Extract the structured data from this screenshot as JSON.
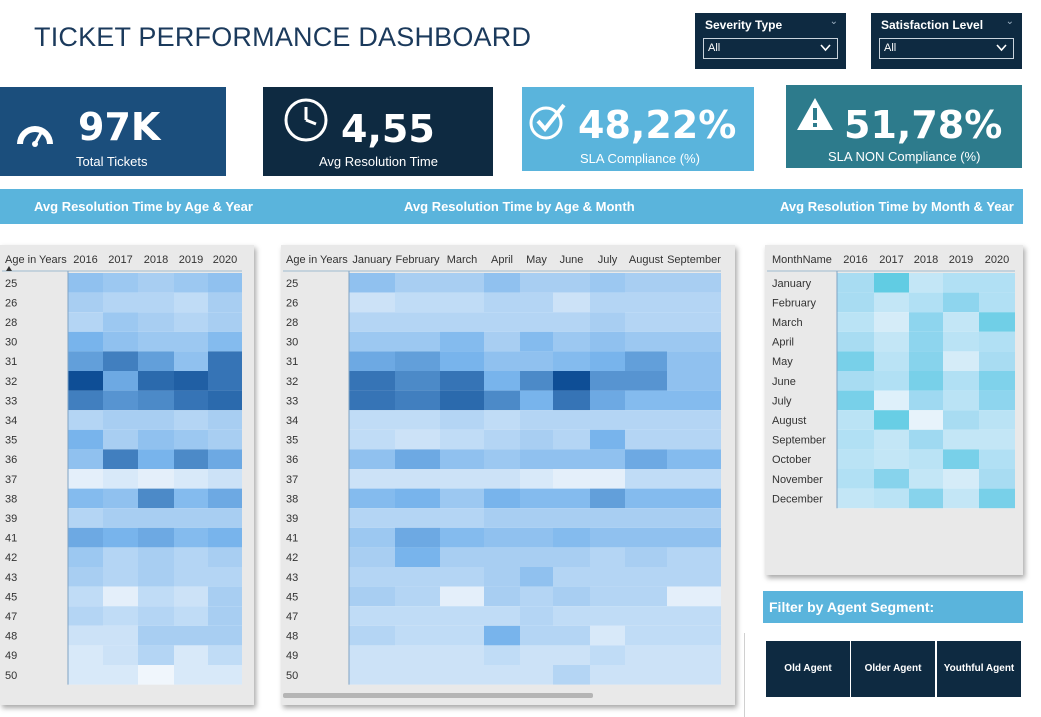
{
  "title": "TICKET PERFORMANCE DASHBOARD",
  "slicers": [
    {
      "label": "Severity Type",
      "value": "All"
    },
    {
      "label": "Satisfaction Level",
      "value": "All"
    }
  ],
  "kpis": [
    {
      "value": "97K",
      "label": "Total Tickets",
      "icon": "speedometer-icon",
      "bg": "#1b4e7c"
    },
    {
      "value": "4,55",
      "label": "Avg Resolution Time",
      "icon": "clock-icon",
      "bg": "#0e2a41"
    },
    {
      "value": "48,22%",
      "label": "SLA Compliance (%)",
      "icon": "check-circle-icon",
      "bg": "#5ab4dc"
    },
    {
      "value": "51,78%",
      "label": "SLA NON Compliance (%)",
      "icon": "warning-icon",
      "bg": "#2d7b8c"
    }
  ],
  "headings": {
    "left": "Avg Resolution Time by Age & Year",
    "mid": "Avg Resolution Time by Age & Month",
    "right": "Avg Resolution Time by Month & Year"
  },
  "filter": {
    "title": "Filter by Agent Segment:",
    "buttons": [
      "Old Agent",
      "Older Agent",
      "Youthful Agent"
    ]
  },
  "chart_data": [
    {
      "type": "heatmap",
      "title": "Avg Resolution Time by Age & Year",
      "row_header": "Age in Years",
      "columns": [
        "2016",
        "2017",
        "2018",
        "2019",
        "2020"
      ],
      "rows": [
        "25",
        "26",
        "28",
        "30",
        "31",
        "32",
        "33",
        "34",
        "35",
        "36",
        "37",
        "38",
        "39",
        "41",
        "42",
        "43",
        "45",
        "47",
        "48",
        "49",
        "50"
      ],
      "values": [
        [
          0.4,
          0.35,
          0.3,
          0.35,
          0.4
        ],
        [
          0.3,
          0.25,
          0.25,
          0.2,
          0.3
        ],
        [
          0.25,
          0.35,
          0.3,
          0.25,
          0.3
        ],
        [
          0.5,
          0.4,
          0.35,
          0.35,
          0.45
        ],
        [
          0.6,
          0.75,
          0.6,
          0.4,
          0.8
        ],
        [
          0.98,
          0.55,
          0.85,
          0.9,
          0.8
        ],
        [
          0.75,
          0.65,
          0.7,
          0.8,
          0.85
        ],
        [
          0.25,
          0.3,
          0.3,
          0.25,
          0.3
        ],
        [
          0.5,
          0.3,
          0.4,
          0.35,
          0.3
        ],
        [
          0.4,
          0.75,
          0.5,
          0.7,
          0.55
        ],
        [
          0.05,
          0.1,
          0.05,
          0.1,
          0.15
        ],
        [
          0.45,
          0.4,
          0.7,
          0.45,
          0.55
        ],
        [
          0.25,
          0.3,
          0.3,
          0.3,
          0.3
        ],
        [
          0.55,
          0.5,
          0.55,
          0.45,
          0.5
        ],
        [
          0.35,
          0.25,
          0.3,
          0.25,
          0.3
        ],
        [
          0.3,
          0.25,
          0.3,
          0.25,
          0.25
        ],
        [
          0.2,
          0.05,
          0.2,
          0.15,
          0.3
        ],
        [
          0.25,
          0.2,
          0.25,
          0.2,
          0.3
        ],
        [
          0.15,
          0.15,
          0.3,
          0.3,
          0.3
        ],
        [
          0.1,
          0.15,
          0.25,
          0.1,
          0.2
        ],
        [
          0.1,
          0.1,
          0.0,
          0.1,
          0.1
        ]
      ]
    },
    {
      "type": "heatmap",
      "title": "Avg Resolution Time by Age & Month",
      "row_header": "Age in Years",
      "columns": [
        "January",
        "February",
        "March",
        "April",
        "May",
        "June",
        "July",
        "August",
        "September"
      ],
      "rows": [
        "25",
        "26",
        "28",
        "30",
        "31",
        "32",
        "33",
        "34",
        "35",
        "36",
        "37",
        "38",
        "39",
        "41",
        "42",
        "43",
        "45",
        "47",
        "48",
        "49",
        "50"
      ],
      "values": [
        [
          0.4,
          0.3,
          0.3,
          0.4,
          0.3,
          0.3,
          0.35,
          0.3,
          0.3
        ],
        [
          0.15,
          0.2,
          0.2,
          0.25,
          0.25,
          0.15,
          0.25,
          0.25,
          0.25
        ],
        [
          0.25,
          0.25,
          0.25,
          0.25,
          0.25,
          0.25,
          0.3,
          0.25,
          0.25
        ],
        [
          0.35,
          0.35,
          0.45,
          0.3,
          0.45,
          0.35,
          0.4,
          0.35,
          0.35
        ],
        [
          0.55,
          0.6,
          0.5,
          0.4,
          0.4,
          0.45,
          0.5,
          0.6,
          0.4
        ],
        [
          0.8,
          0.7,
          0.8,
          0.5,
          0.7,
          0.98,
          0.65,
          0.65,
          0.4
        ],
        [
          0.8,
          0.75,
          0.85,
          0.7,
          0.5,
          0.8,
          0.55,
          0.45,
          0.45
        ],
        [
          0.2,
          0.2,
          0.25,
          0.2,
          0.25,
          0.25,
          0.25,
          0.25,
          0.25
        ],
        [
          0.2,
          0.15,
          0.2,
          0.25,
          0.3,
          0.25,
          0.5,
          0.25,
          0.25
        ],
        [
          0.4,
          0.55,
          0.4,
          0.35,
          0.4,
          0.4,
          0.4,
          0.55,
          0.45
        ],
        [
          0.15,
          0.15,
          0.15,
          0.15,
          0.1,
          0.05,
          0.05,
          0.2,
          0.2
        ],
        [
          0.45,
          0.5,
          0.35,
          0.5,
          0.45,
          0.45,
          0.6,
          0.45,
          0.45
        ],
        [
          0.25,
          0.25,
          0.25,
          0.3,
          0.3,
          0.3,
          0.3,
          0.3,
          0.3
        ],
        [
          0.35,
          0.55,
          0.45,
          0.4,
          0.4,
          0.45,
          0.4,
          0.4,
          0.4
        ],
        [
          0.3,
          0.5,
          0.3,
          0.3,
          0.3,
          0.3,
          0.25,
          0.3,
          0.25
        ],
        [
          0.25,
          0.25,
          0.25,
          0.3,
          0.4,
          0.25,
          0.25,
          0.25,
          0.25
        ],
        [
          0.3,
          0.25,
          0.05,
          0.3,
          0.25,
          0.3,
          0.25,
          0.25,
          0.05
        ],
        [
          0.2,
          0.2,
          0.2,
          0.2,
          0.25,
          0.2,
          0.2,
          0.2,
          0.2
        ],
        [
          0.25,
          0.2,
          0.2,
          0.5,
          0.25,
          0.25,
          0.1,
          0.2,
          0.2
        ],
        [
          0.15,
          0.15,
          0.15,
          0.2,
          0.15,
          0.15,
          0.2,
          0.15,
          0.15
        ],
        [
          0.15,
          0.15,
          0.15,
          0.15,
          0.15,
          0.25,
          0.15,
          0.15,
          0.15
        ]
      ]
    },
    {
      "type": "heatmap",
      "title": "Avg Resolution Time by Month & Year",
      "row_header": "MonthName",
      "columns": [
        "2016",
        "2017",
        "2018",
        "2019",
        "2020"
      ],
      "rows": [
        "January",
        "February",
        "March",
        "April",
        "May",
        "June",
        "July",
        "August",
        "September",
        "October",
        "November",
        "December"
      ],
      "values": [
        [
          0.4,
          0.85,
          0.25,
          0.35,
          0.35
        ],
        [
          0.4,
          0.25,
          0.35,
          0.55,
          0.35
        ],
        [
          0.3,
          0.15,
          0.55,
          0.25,
          0.75
        ],
        [
          0.4,
          0.25,
          0.55,
          0.3,
          0.35
        ],
        [
          0.7,
          0.3,
          0.6,
          0.15,
          0.4
        ],
        [
          0.4,
          0.35,
          0.7,
          0.35,
          0.65
        ],
        [
          0.7,
          0.1,
          0.45,
          0.3,
          0.55
        ],
        [
          0.3,
          0.8,
          0.05,
          0.4,
          0.3
        ],
        [
          0.35,
          0.25,
          0.45,
          0.25,
          0.25
        ],
        [
          0.3,
          0.25,
          0.3,
          0.7,
          0.35
        ],
        [
          0.35,
          0.6,
          0.25,
          0.15,
          0.4
        ],
        [
          0.25,
          0.3,
          0.6,
          0.25,
          0.7
        ]
      ]
    }
  ]
}
